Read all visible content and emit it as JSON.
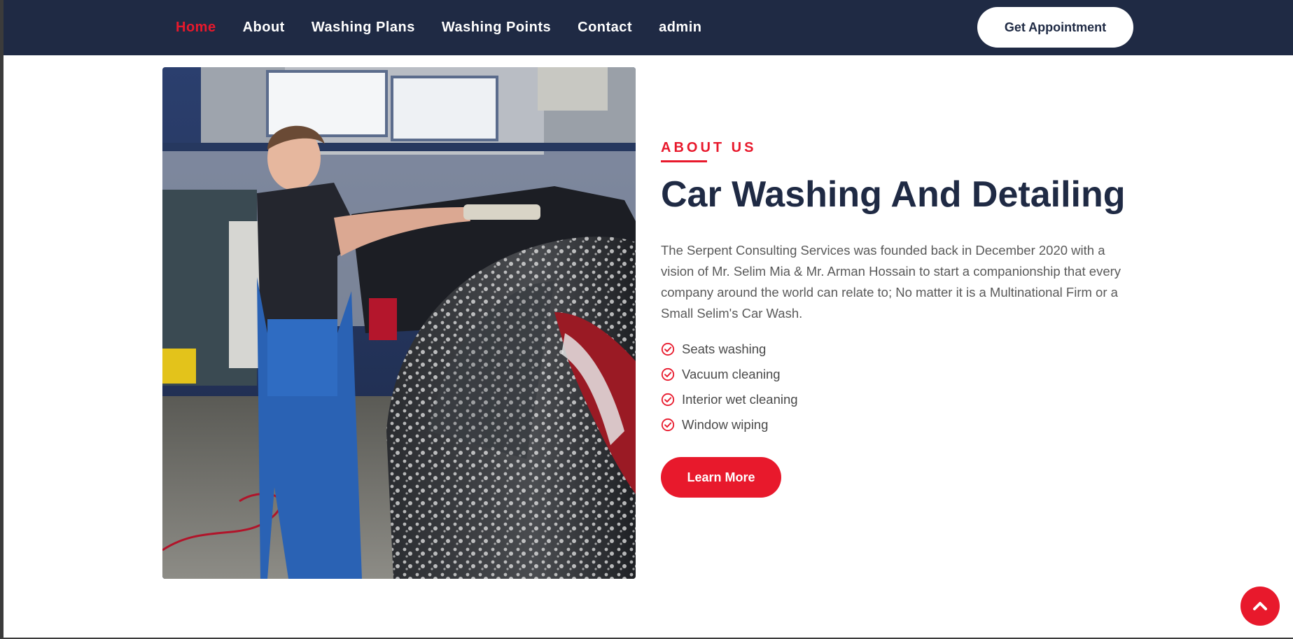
{
  "nav": {
    "items": [
      {
        "label": "Home",
        "active": true
      },
      {
        "label": "About",
        "active": false
      },
      {
        "label": "Washing Plans",
        "active": false
      },
      {
        "label": "Washing Points",
        "active": false
      },
      {
        "label": "Contact",
        "active": false
      },
      {
        "label": "admin",
        "active": false
      }
    ],
    "cta_label": "Get Appointment"
  },
  "about": {
    "eyebrow": "ABOUT US",
    "title": "Car Washing And Detailing",
    "description": "The Serpent Consulting Services was founded back in December 2020 with a vision of Mr. Selim Mia & Mr. Arman Hossain to start a companionship that every company around the world can relate to; No matter it is a Multinational Firm or a Small Selim's Car Wash.",
    "features": [
      "Seats washing",
      "Vacuum cleaning",
      "Interior wet cleaning",
      "Window wiping"
    ],
    "button_label": "Learn More"
  },
  "icons": {
    "feature_icon": "check-circle-icon",
    "scroll_top_icon": "chevron-up-icon"
  },
  "colors": {
    "navbar": "#1f2a44",
    "accent": "#e8192c",
    "heading": "#1f2a44",
    "text": "#5a5a5a"
  }
}
